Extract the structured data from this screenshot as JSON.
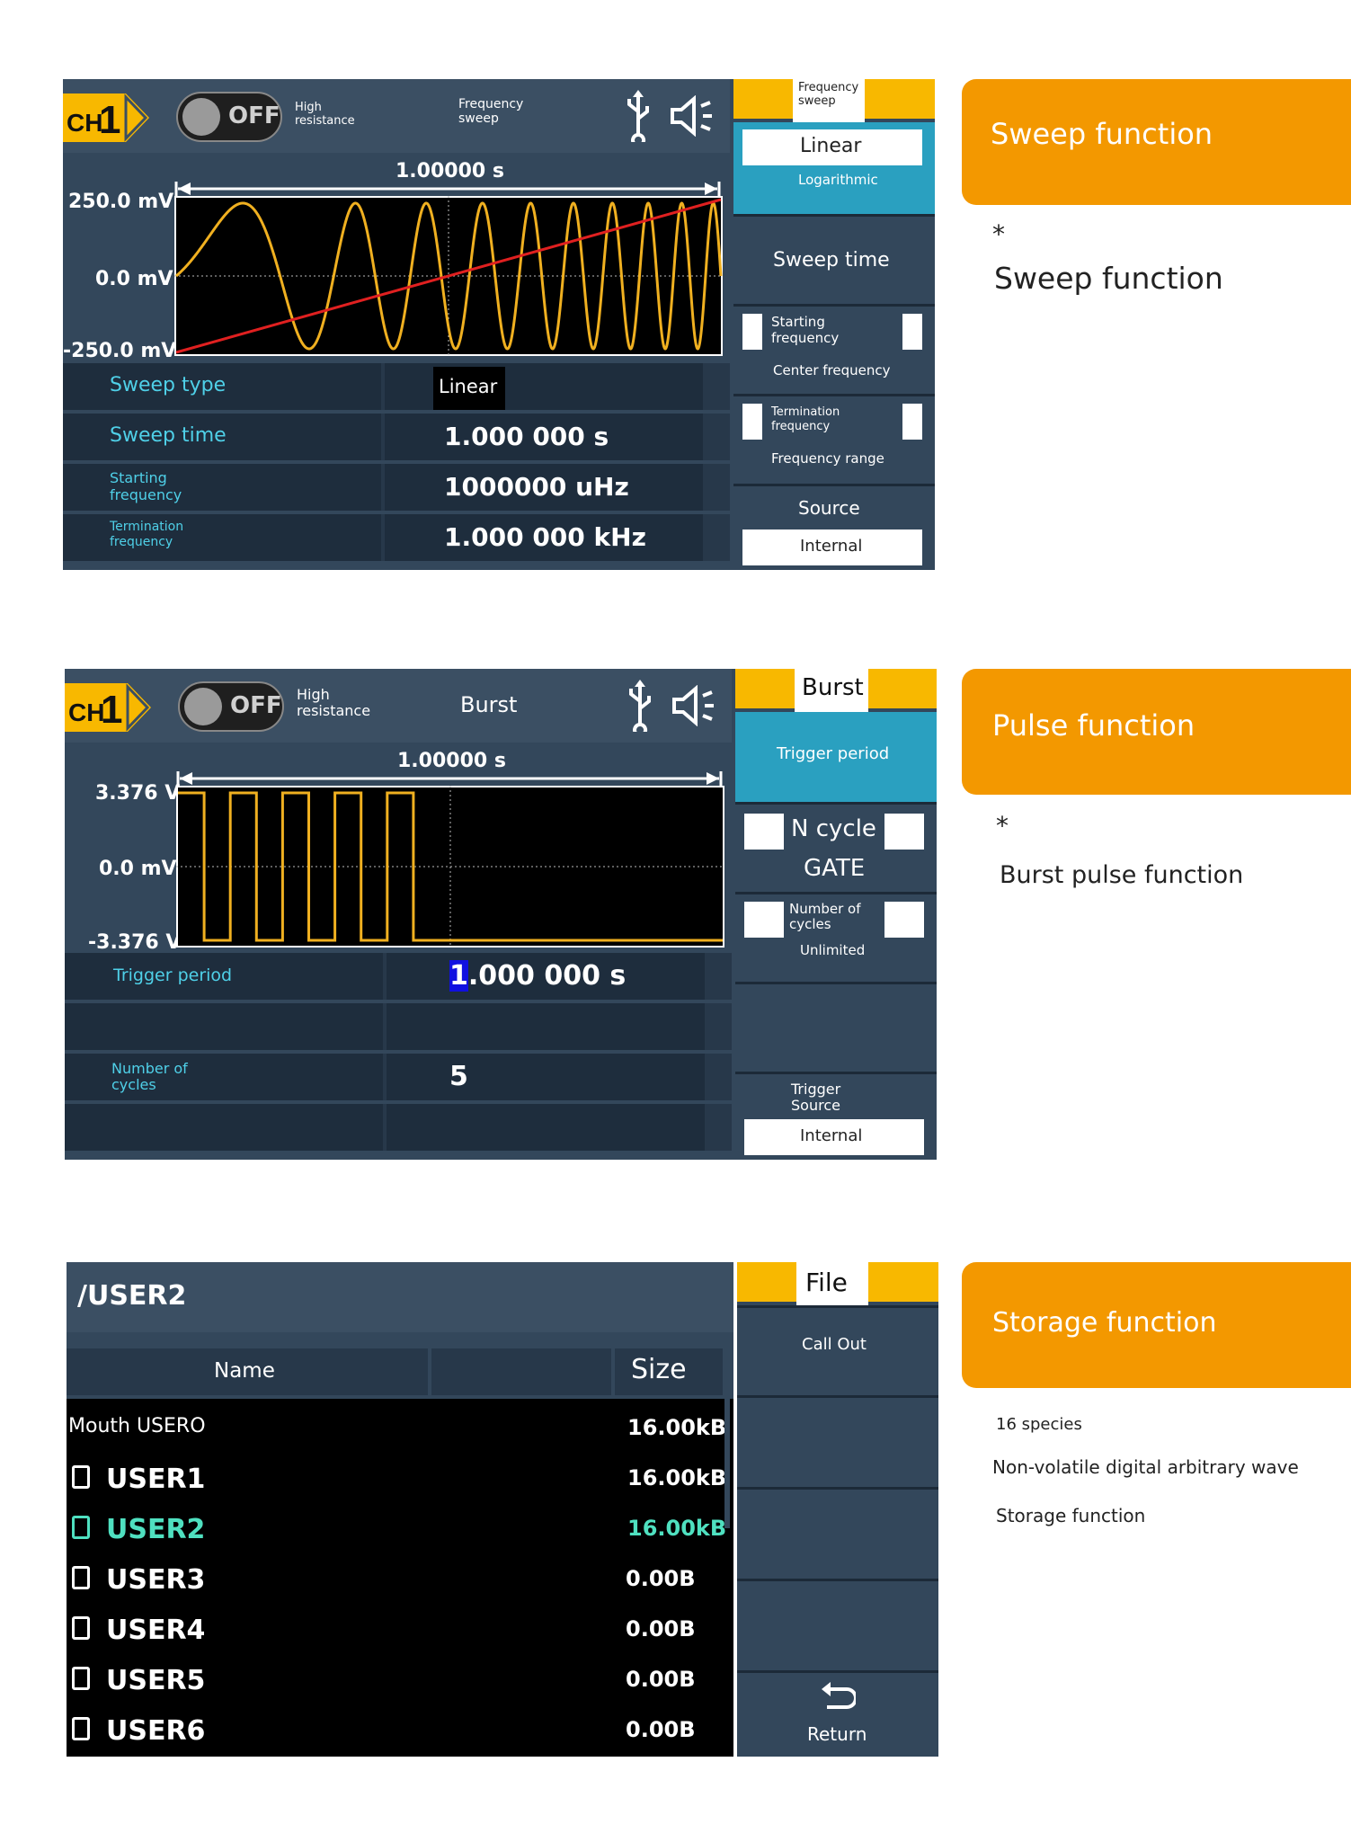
{
  "sections": [
    {
      "id": "sweep",
      "channel": "CH1",
      "output_state": "OFF",
      "impedance": "High resistance",
      "mode": "Frequency sweep",
      "time_span": "1.00000 s",
      "y_labels": [
        "250.0 mV",
        "0.0 mV",
        "-250.0 mV"
      ],
      "params": [
        {
          "label": "Sweep type",
          "value": "Linear"
        },
        {
          "label": "Sweep time",
          "value": "1.000 000 s"
        },
        {
          "label": "Starting frequency",
          "value": "1000000 uHz"
        },
        {
          "label": "Termination frequency",
          "value": "1.000 000 kHz"
        }
      ],
      "softkeys": {
        "title": "Frequency sweep",
        "type_selected": "Linear",
        "type_other": "Logarithmic",
        "sweep_time": "Sweep time",
        "start_label": "Starting frequency",
        "center_label": "Center frequency",
        "term_label": "Termination frequency",
        "range_label": "Frequency range",
        "source_label": "Source",
        "source_value": "Internal"
      },
      "info": {
        "title": "Sweep function",
        "bullet": "*",
        "line1": "Sweep function"
      }
    },
    {
      "id": "burst",
      "channel": "CH1",
      "output_state": "OFF",
      "impedance": "High resistance",
      "mode": "Burst",
      "time_span": "1.00000 s",
      "y_labels": [
        "3.376 V",
        "0.0 mV",
        "-3.376 V"
      ],
      "params": [
        {
          "label": "Trigger period",
          "value": "1.000 000 s",
          "cursor_digit": "1",
          "rest": ".000 000 s"
        },
        {
          "label": "",
          "value": ""
        },
        {
          "label": "Number of cycles",
          "value": "5"
        },
        {
          "label": "",
          "value": ""
        }
      ],
      "softkeys": {
        "title": "Burst",
        "trigger_period": "Trigger period",
        "ncycle": "N cycle",
        "gate": "GATE",
        "num_cycles": "Number of cycles",
        "unlimited": "Unlimited",
        "trigger_source": "Trigger Source",
        "source_value": "Internal"
      },
      "info": {
        "title": "Pulse function",
        "bullet": "*",
        "line1": "Burst pulse function"
      }
    },
    {
      "id": "storage",
      "path": "/USER2",
      "col_name": "Name",
      "col_size": "Size",
      "files": [
        {
          "name": "Mouth USERO",
          "size": "16.00kB",
          "icon": false,
          "selected": false
        },
        {
          "name": "USER1",
          "size": "16.00kB",
          "icon": true,
          "selected": false
        },
        {
          "name": "USER2",
          "size": "16.00kB",
          "icon": true,
          "selected": true
        },
        {
          "name": "USER3",
          "size": "0.00B",
          "icon": true,
          "selected": false
        },
        {
          "name": "USER4",
          "size": "0.00B",
          "icon": true,
          "selected": false
        },
        {
          "name": "USER5",
          "size": "0.00B",
          "icon": true,
          "selected": false
        },
        {
          "name": "USER6",
          "size": "0.00B",
          "icon": true,
          "selected": false
        }
      ],
      "softkeys": {
        "title": "File",
        "call_out": "Call Out",
        "return_label": "Return"
      },
      "info": {
        "title": "Storage function",
        "line1": "16 species",
        "line2": "Non-volatile digital arbitrary wave",
        "line3": "Storage function"
      }
    }
  ],
  "colors": {
    "screen_bg": "#33475b",
    "accent_yellow": "#f8b800",
    "wave_yellow": "#f0b020",
    "sweep_line": "#e02020",
    "cyan_text": "#4fd0e8",
    "orange_banner": "#f39800",
    "selected_file": "#4fe0c0",
    "selected_key": "#2aa0c0"
  },
  "waveforms": {
    "sweep_cycles_end_factor": 18,
    "burst_pulses": 5,
    "burst_duty": 0.5
  }
}
